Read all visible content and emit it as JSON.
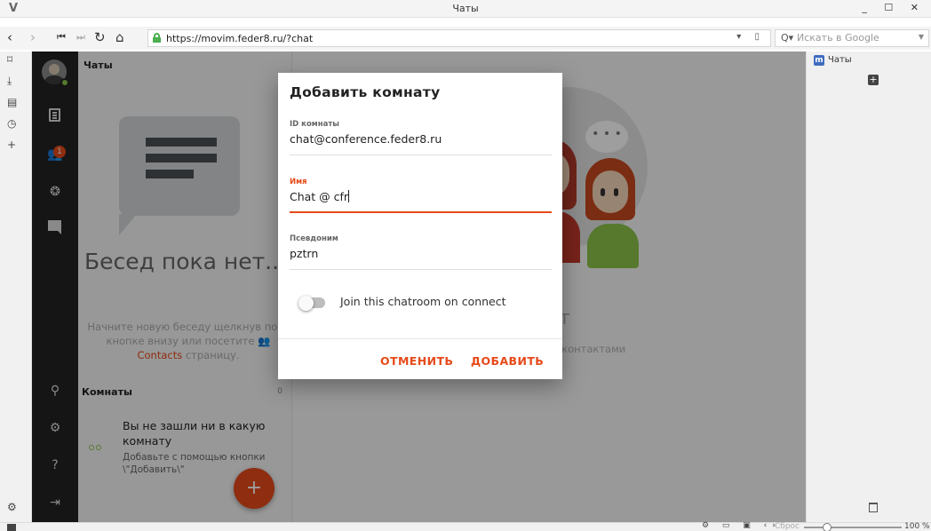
{
  "window": {
    "title": "Чаты"
  },
  "navbar": {
    "url": "https://movim.feder8.ru/?chat",
    "search_placeholder": "Искать в Google"
  },
  "list_panel": {
    "title": "Чаты",
    "empty_title": "Бесед пока нет...",
    "empty_hint_1": "Начните новую беседу щелкнув по + кнопке внизу или посетите",
    "empty_hint_link": "Contacts",
    "empty_hint_2": "страницу.",
    "rooms_header": "Комнаты",
    "rooms_count": "0",
    "room_title": "Вы не зашли ни в какую комнату",
    "room_sub": "Добавьте с помощью кнопки \\\"Добавить\\\"",
    "fab_label": "+"
  },
  "main": {
    "faint_title": "т",
    "faint_text": "и контактами"
  },
  "notifications_badge": "1",
  "dialog": {
    "title": "Добавить комнату",
    "id_label": "ID комнаты",
    "id_value": "chat@conference.feder8.ru",
    "name_label": "Имя",
    "name_value": "Chat @ cfr",
    "nick_label": "Псевдоним",
    "nick_value": "pztrn",
    "toggle_label": "Join this chatroom on connect",
    "toggle_on": false,
    "cancel": "ОТМЕНИТЬ",
    "add": "ДОБАВИТЬ"
  },
  "right_panel": {
    "title": "Чаты"
  },
  "statusbar": {
    "reset": "Сброс",
    "zoom": "100 %"
  },
  "colors": {
    "accent": "#e64a19",
    "online": "#8bc34a",
    "sidebar": "#222222"
  }
}
